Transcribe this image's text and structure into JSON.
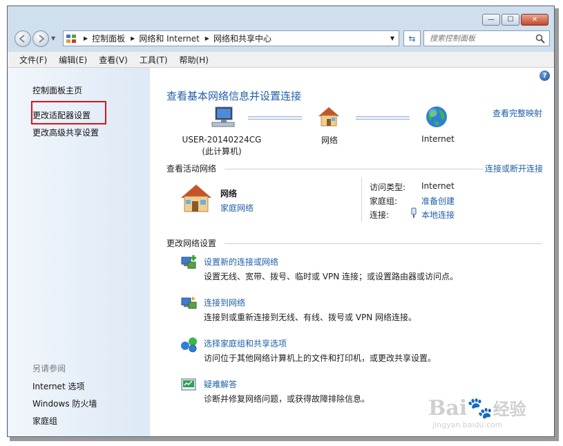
{
  "window": {
    "min_glyph": "—",
    "max_glyph": "☐",
    "close_glyph": "✕"
  },
  "address": {
    "crumbs": [
      "控制面板",
      "网络和 Internet",
      "网络和共享中心"
    ],
    "search_placeholder": "搜索控制面板"
  },
  "menu": [
    "文件(F)",
    "编辑(E)",
    "查看(V)",
    "工具(T)",
    "帮助(H)"
  ],
  "sidebar": {
    "items": [
      "控制面板主页",
      "更改适配器设置",
      "更改高级共享设置"
    ],
    "see_also_header": "另请参阅",
    "see_also": [
      "Internet 选项",
      "Windows 防火墙",
      "家庭组"
    ]
  },
  "main": {
    "title": "查看基本网络信息并设置连接",
    "view_full_map": "查看完整映射",
    "map": {
      "computer": "USER-20140224CG",
      "computer_sub": "(此计算机)",
      "network": "网络",
      "internet": "Internet"
    },
    "active_header": "查看活动网络",
    "connect_disconnect": "连接或断开连接",
    "active_network": {
      "name": "网络",
      "type": "家庭网络",
      "access_type_label": "访问类型:",
      "access_type_value": "Internet",
      "homegroup_label": "家庭组:",
      "homegroup_value": "准备创建",
      "connection_label": "连接:",
      "connection_value": "本地连接"
    },
    "change_header": "更改网络设置",
    "tasks": [
      {
        "title": "设置新的连接或网络",
        "desc": "设置无线、宽带、拨号、临时或 VPN 连接；或设置路由器或访问点。"
      },
      {
        "title": "连接到网络",
        "desc": "连接到或重新连接到无线、有线、拨号或 VPN 网络连接。"
      },
      {
        "title": "选择家庭组和共享选项",
        "desc": "访问位于其他网络计算机上的文件和打印机，或更改共享设置。"
      },
      {
        "title": "疑难解答",
        "desc": "诊断并修复网络问题，或获得故障排除信息。"
      }
    ]
  },
  "watermark": {
    "brand": "Bai",
    "brand2": "经验",
    "url": "jingyan.baidu.com"
  }
}
